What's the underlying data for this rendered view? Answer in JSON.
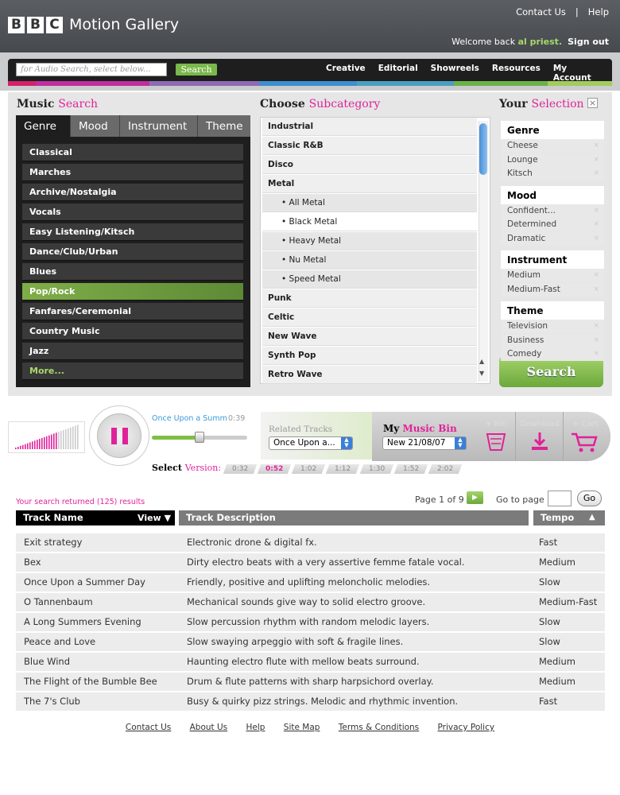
{
  "header": {
    "logo_letters": [
      "B",
      "B",
      "C"
    ],
    "logo_text": "Motion Gallery",
    "contact_us": "Contact Us",
    "separator": "|",
    "help": "Help",
    "welcome_prefix": "Welcome back",
    "user_name": "al priest.",
    "sign_out": "Sign out"
  },
  "nav": {
    "search_placeholder": "for Audio Search, select below...",
    "search_button": "Search",
    "links": [
      "Creative",
      "Editorial",
      "Showreels",
      "Resources",
      "My Account"
    ],
    "strip_colors": [
      "#d3216b",
      "#c02ea0",
      "#8e6bb5",
      "#3d8fcf",
      "#4a9ec2",
      "#6cb24a",
      "#a3cc5b"
    ]
  },
  "music_search": {
    "title_a": "Music",
    "title_b": "Search",
    "tabs": [
      "Genre",
      "Mood",
      "Instrument",
      "Theme"
    ],
    "genres": [
      "Classical",
      "Marches",
      "Archive/Nostalgia",
      "Vocals",
      "Easy Listening/Kitsch",
      "Dance/Club/Urban",
      "Blues",
      "Pop/Rock",
      "Fanfares/Ceremonial",
      "Country Music",
      "Jazz",
      "More..."
    ]
  },
  "subcategory": {
    "title_a": "Choose",
    "title_b": "Subcategory",
    "items": [
      {
        "label": "Industrial",
        "kind": "main"
      },
      {
        "label": "Classic R&B",
        "kind": "main"
      },
      {
        "label": "Disco",
        "kind": "main"
      },
      {
        "label": "Metal",
        "kind": "main"
      },
      {
        "label": "• All Metal",
        "kind": "child"
      },
      {
        "label": "• Black Metal",
        "kind": "child sel"
      },
      {
        "label": "• Heavy Metal",
        "kind": "child"
      },
      {
        "label": "• Nu Metal",
        "kind": "child"
      },
      {
        "label": "• Speed Metal",
        "kind": "child"
      },
      {
        "label": "Punk",
        "kind": "main"
      },
      {
        "label": "Celtic",
        "kind": "main"
      },
      {
        "label": "New Wave",
        "kind": "main"
      },
      {
        "label": "Synth Pop",
        "kind": "main"
      },
      {
        "label": "Retro Wave",
        "kind": "main"
      }
    ]
  },
  "selection": {
    "title_a": "Your",
    "title_b": "Selection",
    "close": "×",
    "groups": [
      {
        "name": "Genre",
        "items": [
          "Cheese",
          "Lounge",
          "Kitsch"
        ]
      },
      {
        "name": "Mood",
        "items": [
          "Confident...",
          "Determined",
          "Dramatic"
        ]
      },
      {
        "name": "Instrument",
        "items": [
          "Medium",
          "Medium-Fast"
        ]
      },
      {
        "name": "Theme",
        "items": [
          "Television",
          "Business",
          "Comedy"
        ]
      }
    ],
    "remove_glyph": "×",
    "search_button": "Search"
  },
  "player": {
    "track": "Once Upon a Summ",
    "time": "0:39",
    "progress": 0.5,
    "related_label": "Related Tracks",
    "related_value": "Once Upon a...",
    "bin_a": "My",
    "bin_b": "Music Bin",
    "bin_value": "New 21/08/07",
    "add_bin": "+ Bin",
    "download": "Download",
    "add_cart": "+ Cart",
    "select_version_a": "Select",
    "select_version_b": "Version:",
    "versions": [
      "0:32",
      "0:52",
      "1:02",
      "1:12",
      "1:30",
      "1:52",
      "2:02"
    ],
    "active_version": "0:52"
  },
  "results": {
    "summary": "Your search returned (125) results",
    "page_label": "Page 1 of 9",
    "goto_label": "Go to page",
    "go_button": "Go",
    "headers": {
      "name": "Track Name",
      "view": "View",
      "desc": "Track Description",
      "tempo": "Tempo"
    },
    "rows": [
      [
        "Exit strategy",
        "Electronic drone & digital fx.",
        "Fast"
      ],
      [
        "Bex",
        "Dirty electro beats with a very assertive femme fatale vocal.",
        "Medium"
      ],
      [
        "Once Upon a Summer Day",
        "Friendly, positive and uplifting meloncholic melodies.",
        "Slow"
      ],
      [
        "O Tannenbaum",
        "Mechanical sounds give way to solid electro groove.",
        "Medium-Fast"
      ],
      [
        "A Long Summers Evening",
        "Slow percussion rhythm with random melodic layers.",
        "Slow"
      ],
      [
        "Peace and Love",
        "Slow swaying arpeggio with soft & fragile lines.",
        "Slow"
      ],
      [
        "Blue Wind",
        "Haunting electro flute with mellow beats surround.",
        "Medium"
      ],
      [
        "The Flight of the Bumble Bee",
        "Drum & flute patterns with sharp harpsichord overlay.",
        "Medium"
      ],
      [
        "The 7's Club",
        "Busy & quirky pizz strings. Melodic and rhythmic invention.",
        "Fast"
      ]
    ]
  },
  "footer": [
    "Contact Us",
    "About Us",
    "Help",
    "Site Map",
    "Terms & Conditions",
    "Privacy Policy"
  ]
}
